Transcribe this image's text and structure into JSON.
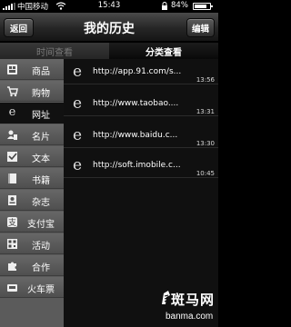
{
  "status_bar": {
    "carrier": "中国移动",
    "time": "15:43",
    "battery_pct": "84%",
    "battery_level": 0.84
  },
  "nav": {
    "back_label": "返回",
    "title": "我的历史",
    "edit_label": "编辑"
  },
  "tabs": [
    {
      "label": "时间查看",
      "selected": false
    },
    {
      "label": "分类查看",
      "selected": true
    }
  ],
  "categories": [
    {
      "label": "商品",
      "icon": "shop-icon",
      "active": false
    },
    {
      "label": "购物",
      "icon": "shopping-cart-icon",
      "active": false
    },
    {
      "label": "网址",
      "icon": "browser-e-icon",
      "active": true
    },
    {
      "label": "名片",
      "icon": "contact-card-icon",
      "active": false
    },
    {
      "label": "文本",
      "icon": "text-check-icon",
      "active": false
    },
    {
      "label": "书籍",
      "icon": "book-icon",
      "active": false
    },
    {
      "label": "杂志",
      "icon": "magazine-icon",
      "active": false
    },
    {
      "label": "支付宝",
      "icon": "alipay-icon",
      "active": false
    },
    {
      "label": "活动",
      "icon": "qr-code-icon",
      "active": false
    },
    {
      "label": "合作",
      "icon": "puzzle-icon",
      "active": false
    },
    {
      "label": "火车票",
      "icon": "train-ticket-icon",
      "active": false
    }
  ],
  "history": [
    {
      "url": "http://app.91.com/s...",
      "time": "13:56"
    },
    {
      "url": "http://www.taobao....",
      "time": "13:31"
    },
    {
      "url": "http://www.baidu.c...",
      "time": "13:30"
    },
    {
      "url": "http://soft.imobile.c...",
      "time": "10:45"
    }
  ],
  "watermark": {
    "text": "斑马网",
    "url": "banma.com"
  }
}
